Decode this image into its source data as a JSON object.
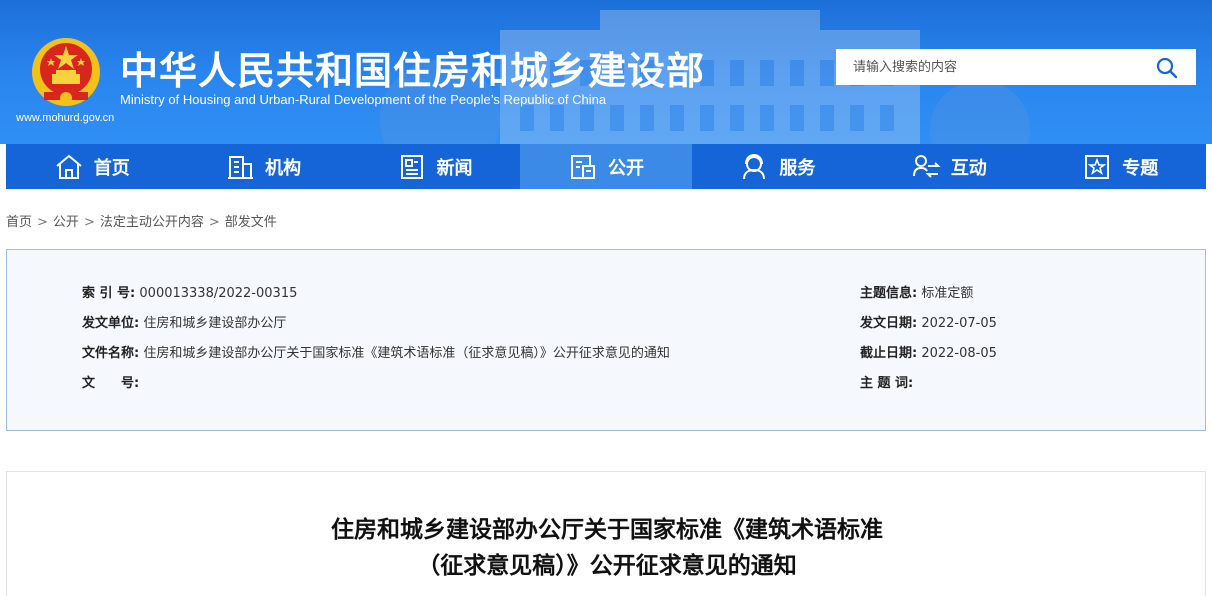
{
  "header": {
    "title_cn": "中华人民共和国住房和城乡建设部",
    "title_en": "Ministry of Housing and Urban-Rural Development of the People’s Republic of China",
    "site_url": "www.mohurd.gov.cn",
    "emblem_icon": "national-emblem-icon",
    "colors": {
      "banner": "#2a86ef",
      "nav": "#1565d8",
      "nav_active": "#3b8ae8"
    }
  },
  "search": {
    "placeholder": "请输入搜索的内容",
    "icon": "search-icon"
  },
  "nav": {
    "items": [
      {
        "label": "首页",
        "icon": "home-icon"
      },
      {
        "label": "机构",
        "icon": "building-icon"
      },
      {
        "label": "新闻",
        "icon": "news-icon"
      },
      {
        "label": "公开",
        "icon": "document-icon",
        "active": true
      },
      {
        "label": "服务",
        "icon": "service-icon"
      },
      {
        "label": "互动",
        "icon": "interaction-icon"
      },
      {
        "label": "专题",
        "icon": "star-icon"
      }
    ]
  },
  "breadcrumb": {
    "items": [
      "首页",
      "公开",
      "法定主动公开内容",
      "部发文件"
    ],
    "separator": ">"
  },
  "info": {
    "index_label": "索 引 号:",
    "index_value": "000013338/2022-00315",
    "issuer_label": "发文单位:",
    "issuer_value": "住房和城乡建设部办公厅",
    "filename_label": "文件名称:",
    "filename_value": "住房和城乡建设部办公厅关于国家标准《建筑术语标准（征求意见稿）》公开征求意见的通知",
    "docno_label": "文　　号:",
    "docno_value": "",
    "topic_label": "主题信息:",
    "topic_value": "标准定额",
    "date_label": "发文日期:",
    "date_value": "2022-07-05",
    "deadline_label": "截止日期:",
    "deadline_value": "2022-08-05",
    "keywords_label": "主 题 词:",
    "keywords_value": ""
  },
  "article": {
    "title_line1": "住房和城乡建设部办公厅关于国家标准《建筑术语标准",
    "title_line2": "（征求意见稿）》公开征求意见的通知"
  }
}
